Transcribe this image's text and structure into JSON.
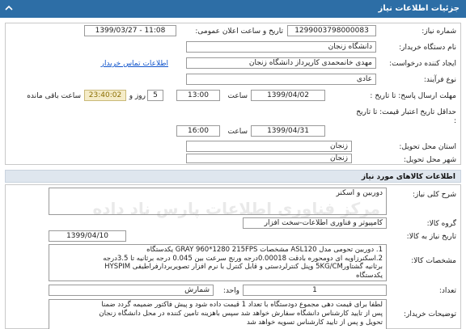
{
  "header": {
    "title": "جزئیات اطلاعات نیاز"
  },
  "need": {
    "number_label": "شماره نیاز:",
    "number": "1299003798000083",
    "announce_label": "تاریخ و ساعت اعلان عمومی:",
    "announce": "1399/03/27 - 11:08",
    "buyer_label": "نام دستگاه خریدار:",
    "buyer": "دانشگاه زنجان",
    "creator_label": "ایجاد کننده درخواست:",
    "creator": "مهدی خانمحمدی کارپرداز دانشگاه زنجان",
    "contact_link": "اطلاعات تماس خریدار",
    "type_label": "نوع فرآیند:",
    "type": "عادی",
    "deadline_label": "مهلت ارسال پاسخ: تا تاریخ :",
    "deadline_date": "1399/04/02",
    "time_label": "ساعت",
    "deadline_time": "13:00",
    "days": "5",
    "days_label": "روز و",
    "remaining": "23:40:02",
    "remaining_label": "ساعت باقی مانده",
    "validity_label": "حداقل تاریخ اعتبار قیمت: تا تاریخ :",
    "validity_date": "1399/04/31",
    "validity_time": "16:00",
    "province_label": "استان محل تحویل:",
    "province": "زنجان",
    "city_label": "شهر محل تحویل:",
    "city": "زنجان"
  },
  "goods": {
    "section_title": "اطلاعات کالاهای مورد نیاز",
    "summary_label": "شرح کلی نیاز:",
    "summary": "دوربین و اسکنر",
    "group_label": "گروه کالا:",
    "group": "کامپیوتر و فناوری اطلاعات-سخت افزار",
    "need_date_label": "تاریخ نیاز به کالا:",
    "need_date": "1399/04/10",
    "specs_label": "مشخصات کالا:",
    "specs_line1": "1. دوربین تحومی مدل ASL120 مشخصات GRAY 960*1280  215FPS یکدستگاه",
    "specs_line2": "2.اسکنرزاویه ای دومحوره بادقت 0.00018درجه ورنج سرعت بین 0.045 درجه برثانیه تا 3.5درجه",
    "specs_line3": "برثانیه گشتاور5KG/CM وپنل کنترلردستی و قابل کنترل با نرم افزار تصویربردارفراطیفی HYSPIM",
    "specs_line4": "یکدستگاه",
    "qty_label": "تعداد:",
    "qty": "1",
    "unit_label": "واحد:",
    "unit": "شمارش",
    "notes_label": "توضیحات خریدار:",
    "notes_line1": "لطفا برای قیمت دهی مجموع دودستگاه با تعداد 1 قیمت داده شود و پیش فاکتور ضمیمه گردد ضمنا",
    "notes_line2": "پس از تایید کارشناس دانشگاه سفارش خواهد شد سپس باهزینه تامین کننده در محل دانشگاه زنجان",
    "notes_line3": "تحویل و پس از تایید کارشناس تسویه خواهد شد"
  },
  "watermark": "مرکز فناوری اطلاعات پارس ناد داده"
}
